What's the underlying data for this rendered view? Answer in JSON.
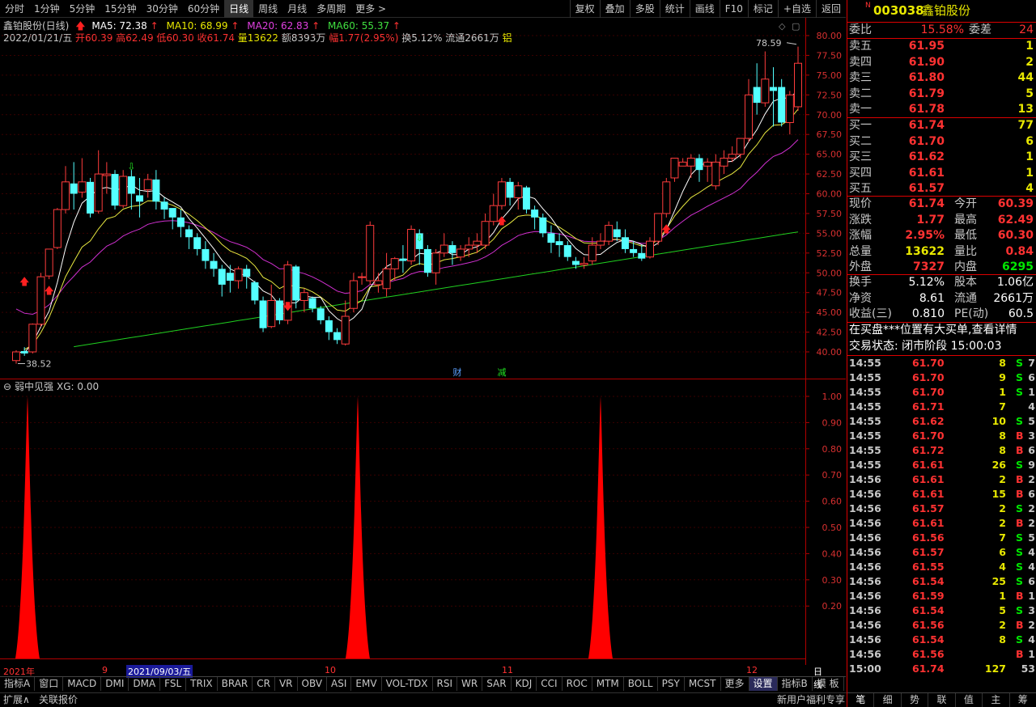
{
  "toolbar": {
    "periods": [
      "分时",
      "1分钟",
      "5分钟",
      "15分钟",
      "30分钟",
      "60分钟",
      "日线",
      "周线",
      "月线",
      "多周期",
      "更多 >"
    ],
    "active_period": "日线",
    "right_buttons": [
      "复权",
      "叠加",
      "多股",
      "统计",
      "画线",
      "F10",
      "标记",
      "+自选",
      "返回"
    ]
  },
  "chart_header": {
    "title": "鑫铂股份(日线)",
    "ma5": "MA5: 72.38",
    "ma10": "MA10: 68.99",
    "ma20": "MA20: 62.83",
    "ma60": "MA60: 55.37",
    "ohlc_date": "2022/01/21/五",
    "open": "开60.39",
    "high": "高62.49",
    "low": "低60.30",
    "close": "收61.74",
    "volume": "量13622",
    "amount": "额8393万",
    "change": "幅1.77(2.95%)",
    "turnover": "换5.12%",
    "float": "流通2661万",
    "sector": "铝"
  },
  "main_chart": {
    "y_ticks": [
      "80.00",
      "77.50",
      "75.00",
      "72.50",
      "70.00",
      "67.50",
      "65.00",
      "62.50",
      "60.00",
      "57.50",
      "55.00",
      "52.50",
      "50.00",
      "47.50",
      "45.00",
      "42.50",
      "40.00"
    ],
    "max_label": "78.59",
    "min_label": "38.52",
    "event_labels": [
      "财",
      "减"
    ]
  },
  "indicator": {
    "title": "弱中见强",
    "xg": "XG: 0.00",
    "y_ticks": [
      "1.00",
      "0.90",
      "0.80",
      "0.70",
      "0.60",
      "0.50",
      "0.40",
      "0.30",
      "0.20"
    ]
  },
  "xaxis": {
    "labels": [
      "2021年",
      "9",
      "2021/09/03/五",
      "10",
      "11",
      "12"
    ],
    "unit_btn": "日线"
  },
  "bottom_tabs": [
    "指标A",
    "窗口",
    "MACD",
    "DMI",
    "DMA",
    "FSL",
    "TRIX",
    "BRAR",
    "CR",
    "VR",
    "OBV",
    "ASI",
    "EMV",
    "VOL-TDX",
    "RSI",
    "WR",
    "SAR",
    "KDJ",
    "CCI",
    "ROC",
    "MTM",
    "BOLL",
    "PSY",
    "MCST",
    "更多",
    "设置"
  ],
  "bottom_right_tabs": [
    "指标B",
    "模 板",
    "+",
    "−"
  ],
  "status_bar": {
    "left": [
      "扩展∧",
      "关联报价"
    ],
    "right": "新用户福利专享",
    "right_tabs": [
      "笔",
      "细",
      "势",
      "联",
      "值",
      "主",
      "筹"
    ]
  },
  "stock": {
    "badge": "N",
    "code": "003038",
    "name": "鑫铂股份",
    "weibi_label": "委比",
    "weibi": "15.58%",
    "weicha_label": "委差",
    "weicha": "24",
    "asks": [
      {
        "label": "卖五",
        "price": "61.95",
        "vol": "1"
      },
      {
        "label": "卖四",
        "price": "61.90",
        "vol": "2"
      },
      {
        "label": "卖三",
        "price": "61.80",
        "vol": "44"
      },
      {
        "label": "卖二",
        "price": "61.79",
        "vol": "5"
      },
      {
        "label": "卖一",
        "price": "61.78",
        "vol": "13"
      }
    ],
    "bids": [
      {
        "label": "买一",
        "price": "61.74",
        "vol": "77"
      },
      {
        "label": "买二",
        "price": "61.70",
        "vol": "6"
      },
      {
        "label": "买三",
        "price": "61.62",
        "vol": "1"
      },
      {
        "label": "买四",
        "price": "61.61",
        "vol": "1"
      },
      {
        "label": "买五",
        "price": "61.57",
        "vol": "4"
      }
    ],
    "stats": [
      {
        "l1": "现价",
        "v1": "61.74",
        "l2": "今开",
        "v2": "60.39"
      },
      {
        "l1": "涨跌",
        "v1": "1.77",
        "l2": "最高",
        "v2": "62.49"
      },
      {
        "l1": "涨幅",
        "v1": "2.95%",
        "l2": "最低",
        "v2": "60.30"
      },
      {
        "l1": "总量",
        "v1": "13622",
        "l2": "量比",
        "v2": "0.84"
      },
      {
        "l1": "外盘",
        "v1": "7327",
        "l2": "内盘",
        "v2": "6295"
      }
    ],
    "stats2": [
      {
        "l1": "换手",
        "v1": "5.12%",
        "l2": "股本",
        "v2": "1.06亿"
      },
      {
        "l1": "净资",
        "v1": "8.61",
        "l2": "流通",
        "v2": "2661万"
      },
      {
        "l1": "收益(三)",
        "v1": "0.810",
        "l2": "PE(动)",
        "v2": "60.5"
      }
    ],
    "notice": "在买盘***位置有大买单,查看详情",
    "trade_state": "交易状态: 闭市阶段 15:00:03"
  },
  "ticks": [
    {
      "t": "14:55",
      "p": "61.70",
      "v": "8",
      "bs": "S",
      "n": "7"
    },
    {
      "t": "14:55",
      "p": "61.70",
      "v": "9",
      "bs": "S",
      "n": "6"
    },
    {
      "t": "14:55",
      "p": "61.70",
      "v": "1",
      "bs": "S",
      "n": "1"
    },
    {
      "t": "14:55",
      "p": "61.71",
      "v": "7",
      "bs": "",
      "n": "4"
    },
    {
      "t": "14:55",
      "p": "61.62",
      "v": "10",
      "bs": "S",
      "n": "5"
    },
    {
      "t": "14:55",
      "p": "61.70",
      "v": "8",
      "bs": "B",
      "n": "3"
    },
    {
      "t": "14:55",
      "p": "61.72",
      "v": "8",
      "bs": "B",
      "n": "6"
    },
    {
      "t": "14:55",
      "p": "61.61",
      "v": "26",
      "bs": "S",
      "n": "9"
    },
    {
      "t": "14:56",
      "p": "61.61",
      "v": "2",
      "bs": "B",
      "n": "2"
    },
    {
      "t": "14:56",
      "p": "61.61",
      "v": "15",
      "bs": "B",
      "n": "6"
    },
    {
      "t": "14:56",
      "p": "61.57",
      "v": "2",
      "bs": "S",
      "n": "2"
    },
    {
      "t": "14:56",
      "p": "61.61",
      "v": "2",
      "bs": "B",
      "n": "2"
    },
    {
      "t": "14:56",
      "p": "61.56",
      "v": "7",
      "bs": "S",
      "n": "5"
    },
    {
      "t": "14:56",
      "p": "61.57",
      "v": "6",
      "bs": "S",
      "n": "4"
    },
    {
      "t": "14:56",
      "p": "61.55",
      "v": "4",
      "bs": "S",
      "n": "4"
    },
    {
      "t": "14:56",
      "p": "61.54",
      "v": "25",
      "bs": "S",
      "n": "6"
    },
    {
      "t": "14:56",
      "p": "61.59",
      "v": "1",
      "bs": "B",
      "n": "1"
    },
    {
      "t": "14:56",
      "p": "61.54",
      "v": "5",
      "bs": "S",
      "n": "3"
    },
    {
      "t": "14:56",
      "p": "61.56",
      "v": "2",
      "bs": "B",
      "n": "2"
    },
    {
      "t": "14:56",
      "p": "61.54",
      "v": "8",
      "bs": "S",
      "n": "4"
    },
    {
      "t": "14:56",
      "p": "61.56",
      "v": "",
      "bs": "B",
      "n": "1"
    },
    {
      "t": "15:00",
      "p": "61.74",
      "v": "127",
      "bs": "",
      "n": "53"
    }
  ],
  "candles": [
    [
      38.9,
      40.0,
      38.5,
      40.2
    ],
    [
      40.1,
      39.8,
      39.5,
      40.6
    ],
    [
      40.0,
      43.5,
      39.8,
      43.6
    ],
    [
      43.5,
      49.5,
      43.2,
      50.0
    ],
    [
      49.6,
      53.0,
      49.2,
      53.0
    ],
    [
      53.2,
      58.0,
      53.0,
      58.2
    ],
    [
      58.0,
      61.5,
      57.5,
      63.5
    ],
    [
      61.3,
      60.0,
      58.0,
      64.0
    ],
    [
      60.2,
      61.5,
      59.5,
      64.5
    ],
    [
      61.5,
      57.5,
      57.0,
      62.0
    ],
    [
      57.8,
      62.5,
      57.5,
      65.5
    ],
    [
      62.3,
      62.5,
      60.0,
      64.0
    ],
    [
      62.5,
      58.5,
      58.0,
      63.0
    ],
    [
      58.5,
      62.2,
      58.2,
      63.0
    ],
    [
      62.2,
      60.0,
      58.0,
      63.0
    ],
    [
      59.8,
      59.0,
      57.0,
      62.0
    ],
    [
      60.5,
      61.8,
      59.5,
      62.5
    ],
    [
      61.8,
      59.0,
      58.0,
      63.0
    ],
    [
      59.0,
      58.0,
      56.8,
      59.5
    ],
    [
      58.2,
      57.0,
      55.5,
      58.0
    ],
    [
      57.0,
      55.8,
      54.5,
      58.0
    ],
    [
      55.5,
      54.5,
      53.0,
      56.0
    ],
    [
      54.5,
      53.0,
      52.2,
      55.0
    ],
    [
      53.0,
      51.5,
      50.5,
      54.0
    ],
    [
      51.5,
      50.5,
      49.5,
      52.5
    ],
    [
      50.5,
      48.5,
      47.0,
      51.0
    ],
    [
      50.0,
      49.0,
      47.5,
      51.0
    ],
    [
      49.0,
      50.5,
      48.0,
      50.8
    ],
    [
      50.5,
      49.5,
      48.0,
      51.0
    ],
    [
      48.8,
      46.5,
      46.0,
      49.0
    ],
    [
      46.5,
      43.0,
      42.5,
      47.0
    ],
    [
      43.2,
      46.5,
      43.0,
      48.5
    ],
    [
      46.5,
      44.0,
      43.5,
      46.8
    ],
    [
      44.0,
      51.0,
      43.5,
      51.5
    ],
    [
      50.8,
      46.5,
      45.5,
      51.0
    ],
    [
      46.5,
      47.5,
      45.0,
      48.0
    ],
    [
      46.8,
      45.5,
      45.0,
      47.0
    ],
    [
      45.5,
      44.0,
      43.5,
      45.8
    ],
    [
      44.0,
      42.5,
      41.5,
      44.5
    ],
    [
      42.5,
      41.5,
      41.0,
      43.0
    ],
    [
      41.0,
      44.5,
      40.8,
      46.5
    ],
    [
      45.5,
      49.0,
      45.0,
      50.0
    ],
    [
      49.5,
      49.5,
      48.5,
      50.0
    ],
    [
      49.0,
      56.0,
      48.5,
      56.5
    ],
    [
      48.5,
      49.0,
      47.5,
      50.0
    ],
    [
      48.0,
      50.5,
      47.0,
      52.5
    ],
    [
      50.5,
      51.8,
      49.0,
      52.0
    ],
    [
      51.8,
      51.5,
      50.0,
      53.5
    ],
    [
      51.5,
      55.5,
      51.0,
      56.0
    ],
    [
      55.0,
      53.0,
      51.0,
      55.5
    ],
    [
      53.0,
      50.0,
      49.5,
      53.5
    ],
    [
      50.0,
      52.5,
      48.5,
      53.0
    ],
    [
      52.5,
      53.5,
      52.0,
      55.0
    ],
    [
      53.5,
      52.5,
      51.0,
      54.0
    ],
    [
      52.0,
      53.0,
      51.5,
      53.5
    ],
    [
      53.0,
      53.5,
      52.0,
      54.5
    ],
    [
      53.5,
      54.0,
      52.5,
      55.0
    ],
    [
      53.5,
      56.5,
      53.0,
      57.5
    ],
    [
      56.5,
      58.5,
      56.0,
      60.0
    ],
    [
      58.5,
      61.5,
      58.0,
      62.0
    ],
    [
      61.5,
      59.5,
      58.5,
      62.0
    ],
    [
      59.5,
      61.0,
      58.0,
      61.5
    ],
    [
      60.8,
      58.0,
      57.5,
      61.0
    ],
    [
      58.0,
      57.0,
      55.5,
      58.5
    ],
    [
      57.0,
      55.0,
      54.5,
      57.5
    ],
    [
      55.0,
      53.8,
      52.5,
      56.0
    ],
    [
      54.0,
      53.5,
      52.0,
      55.0
    ],
    [
      53.5,
      52.0,
      51.5,
      54.0
    ],
    [
      51.5,
      51.0,
      50.5,
      52.0
    ],
    [
      51.0,
      51.2,
      50.5,
      52.0
    ],
    [
      51.5,
      53.5,
      51.0,
      54.5
    ],
    [
      53.5,
      54.0,
      53.0,
      55.0
    ],
    [
      54.0,
      56.0,
      53.5,
      56.5
    ],
    [
      55.5,
      54.5,
      54.0,
      56.5
    ],
    [
      54.5,
      53.0,
      52.5,
      55.5
    ],
    [
      53.0,
      52.5,
      52.0,
      54.0
    ],
    [
      52.5,
      51.8,
      51.5,
      53.5
    ],
    [
      52.0,
      54.0,
      51.8,
      54.5
    ],
    [
      54.0,
      57.5,
      53.5,
      57.5
    ],
    [
      57.5,
      61.5,
      57.0,
      62.0
    ],
    [
      62.0,
      64.5,
      61.5,
      64.5
    ],
    [
      63.5,
      64.0,
      63.5,
      64.5
    ],
    [
      63.5,
      64.5,
      62.0,
      65.0
    ],
    [
      64.5,
      63.0,
      61.5,
      65.0
    ],
    [
      63.5,
      64.0,
      61.5,
      64.5
    ],
    [
      61.0,
      64.0,
      60.5,
      65.0
    ],
    [
      63.5,
      64.5,
      62.5,
      65.5
    ],
    [
      64.5,
      65.0,
      64.0,
      66.0
    ],
    [
      65.0,
      67.0,
      64.5,
      67.0
    ],
    [
      67.0,
      72.5,
      66.5,
      74.5
    ],
    [
      73.5,
      71.5,
      70.0,
      76.5
    ],
    [
      71.5,
      74.5,
      71.0,
      78.0
    ],
    [
      73.5,
      73.0,
      68.5,
      76.0
    ],
    [
      73.5,
      69.0,
      68.5,
      74.5
    ],
    [
      69.0,
      72.5,
      67.5,
      73.0
    ],
    [
      71.0,
      76.5,
      70.5,
      78.6
    ]
  ],
  "signals_xg": [
    1,
    42,
    80
  ]
}
